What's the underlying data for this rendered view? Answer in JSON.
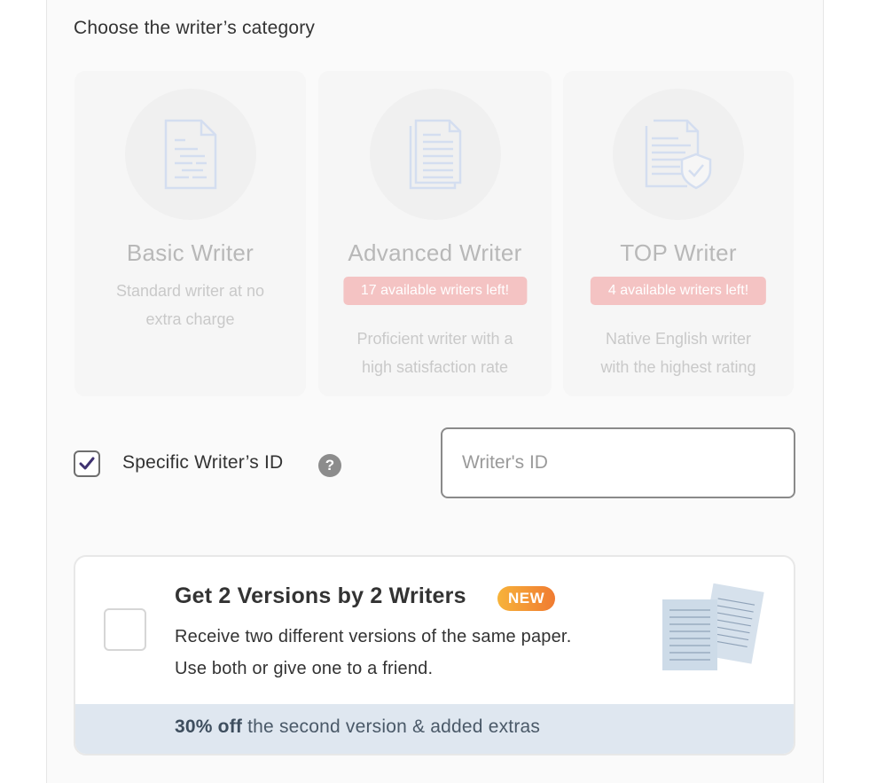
{
  "section_title": "Choose the writer’s category",
  "categories": [
    {
      "name": "Basic Writer",
      "badge": "",
      "description_lines": [
        "Standard writer at no",
        "extra charge"
      ],
      "icon": "document-icon"
    },
    {
      "name": "Advanced Writer",
      "badge": "17 available writers left!",
      "description_lines": [
        "Proficient writer with a",
        "high satisfaction rate"
      ],
      "icon": "document-stack-icon"
    },
    {
      "name": "TOP Writer",
      "badge": "4 available writers left!",
      "description_lines": [
        "Native English writer",
        "with the highest rating"
      ],
      "icon": "document-shield-icon"
    }
  ],
  "specific_writer": {
    "checked": true,
    "label": "Specific Writer’s ID",
    "help_glyph": "?",
    "input_placeholder": "Writer's ID",
    "input_value": ""
  },
  "versions_offer": {
    "title": "Get 2 Versions by 2 Writers",
    "badge": "NEW",
    "description_lines": [
      "Receive two different versions of the same paper.",
      "Use both or give one to a friend."
    ],
    "footer_bold": "30% off",
    "footer_text": " the second version & added extras",
    "checked": false
  },
  "colors": {
    "badge_bg": "#f4c3c3",
    "new_badge": "#f39a35",
    "footer_bg": "#dfe7f0",
    "icon_blue": "#d4def0"
  }
}
